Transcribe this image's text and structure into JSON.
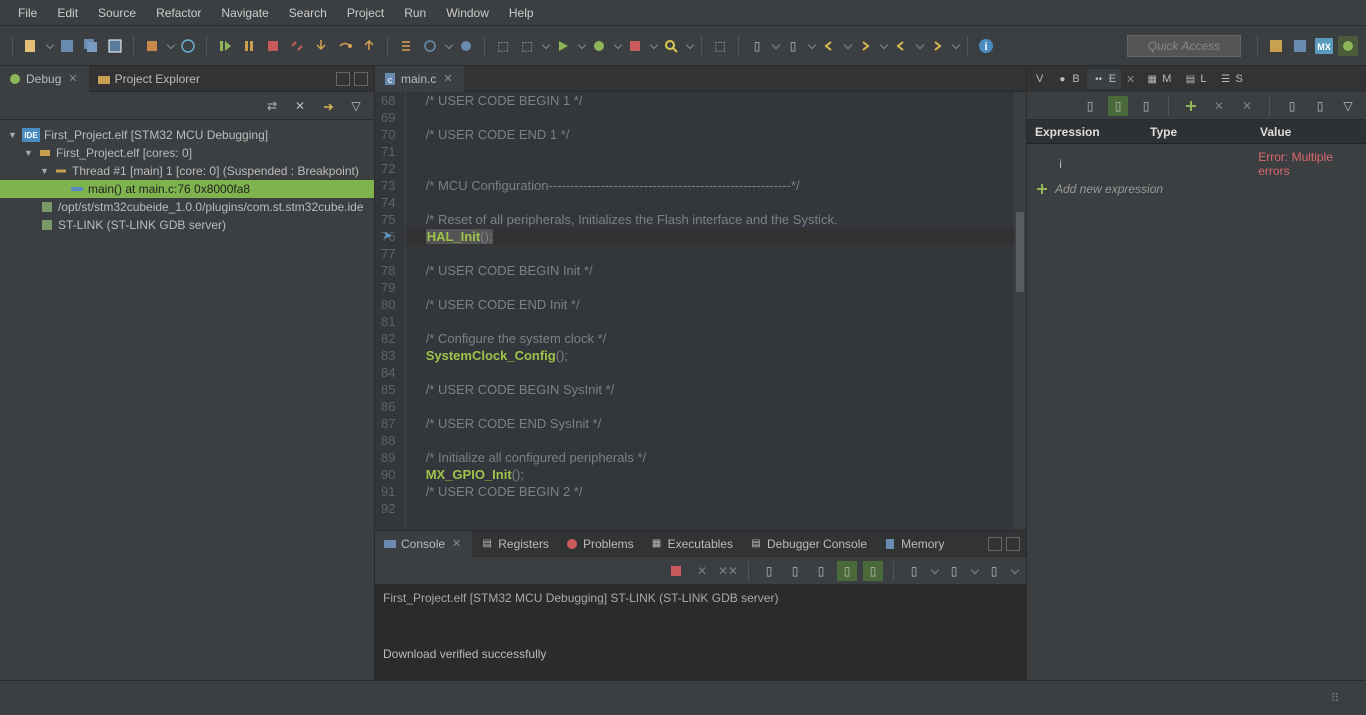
{
  "menu": [
    "File",
    "Edit",
    "Source",
    "Refactor",
    "Navigate",
    "Search",
    "Project",
    "Run",
    "Window",
    "Help"
  ],
  "quick_access": "Quick Access",
  "left": {
    "tabs": [
      "Debug",
      "Project Explorer"
    ],
    "tree": {
      "root": "First_Project.elf [STM32 MCU Debugging]",
      "proc": "First_Project.elf [cores: 0]",
      "thread": "Thread #1 [main] 1 [core: 0] (Suspended : Breakpoint)",
      "frame": "main() at main.c:76 0x8000fa8",
      "plugin": "/opt/st/stm32cubeide_1.0.0/plugins/com.st.stm32cube.ide",
      "stlink": "ST-LINK (ST-LINK GDB server)"
    }
  },
  "editor": {
    "tab": "main.c",
    "lines": [
      {
        "n": 68,
        "t": "  /* USER CODE BEGIN 1 */"
      },
      {
        "n": 69,
        "t": ""
      },
      {
        "n": 70,
        "t": "  /* USER CODE END 1 */"
      },
      {
        "n": 71,
        "t": ""
      },
      {
        "n": 72,
        "t": ""
      },
      {
        "n": 73,
        "t": "  /* MCU Configuration--------------------------------------------------------*/"
      },
      {
        "n": 74,
        "t": ""
      },
      {
        "n": 75,
        "t": "  /* Reset of all peripherals, Initializes the Flash interface and the Systick."
      },
      {
        "n": 76,
        "t": "  HAL_Init();",
        "cur": true,
        "fn": "HAL_Init"
      },
      {
        "n": 77,
        "t": ""
      },
      {
        "n": 78,
        "t": "  /* USER CODE BEGIN Init */"
      },
      {
        "n": 79,
        "t": ""
      },
      {
        "n": 80,
        "t": "  /* USER CODE END Init */"
      },
      {
        "n": 81,
        "t": ""
      },
      {
        "n": 82,
        "t": "  /* Configure the system clock */"
      },
      {
        "n": 83,
        "t": "  SystemClock_Config();",
        "fn": "SystemClock_Config"
      },
      {
        "n": 84,
        "t": ""
      },
      {
        "n": 85,
        "t": "  /* USER CODE BEGIN SysInit */"
      },
      {
        "n": 86,
        "t": ""
      },
      {
        "n": 87,
        "t": "  /* USER CODE END SysInit */"
      },
      {
        "n": 88,
        "t": ""
      },
      {
        "n": 89,
        "t": "  /* Initialize all configured peripherals */"
      },
      {
        "n": 90,
        "t": "  MX_GPIO_Init();",
        "fn": "MX_GPIO_Init"
      },
      {
        "n": 91,
        "t": "  /* USER CODE BEGIN 2 */"
      },
      {
        "n": 92,
        "t": ""
      }
    ]
  },
  "right": {
    "tabs": [
      "V",
      "B",
      "E",
      "M",
      "L",
      "S"
    ],
    "headers": [
      "Expression",
      "Type",
      "Value"
    ],
    "rows": [
      {
        "expr": "i",
        "value": "Error: Multiple errors"
      }
    ],
    "add": "Add new expression"
  },
  "bottom": {
    "tabs": [
      "Console",
      "Registers",
      "Problems",
      "Executables",
      "Debugger Console",
      "Memory"
    ],
    "title": "First_Project.elf [STM32 MCU Debugging] ST-LINK (ST-LINK GDB server)",
    "output": "Download verified successfully"
  }
}
